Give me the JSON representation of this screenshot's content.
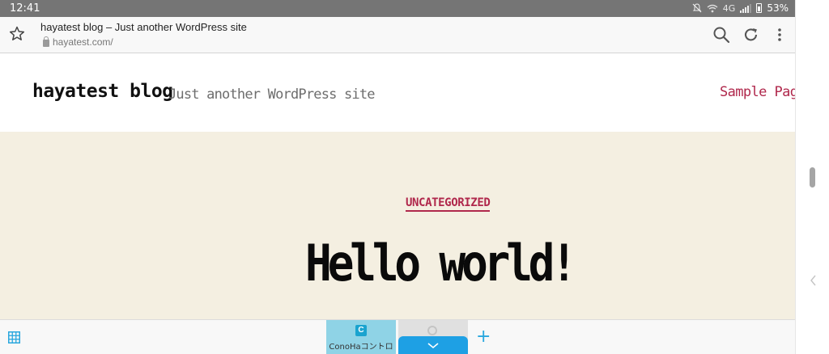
{
  "status_bar": {
    "time": "12:41",
    "network": "4G",
    "battery": "53%",
    "icons": [
      "mute-bell-icon",
      "wifi-icon",
      "signal-icon",
      "battery-icon"
    ]
  },
  "browser": {
    "page_title": "hayatest blog – Just another WordPress site",
    "url": "hayatest.com/",
    "icons": [
      "bookmark-star-icon",
      "lock-icon",
      "search-icon",
      "reload-icon",
      "more-menu-icon"
    ]
  },
  "site": {
    "title": "hayatest blog",
    "description": "Just another WordPress site",
    "nav": {
      "sample_page": "Sample Page"
    }
  },
  "post": {
    "category": "UNCATEGORIZED",
    "title": "Hello world!"
  },
  "bottom_bar": {
    "tabs": [
      {
        "label": "ConoHaコントロ",
        "icon_letter": "C"
      }
    ],
    "icons": [
      "tab-grid-icon",
      "new-tab-plus-icon",
      "chevron-down-icon"
    ]
  },
  "colors": {
    "accent": "#b0284c",
    "hero_bg": "#f4efe1",
    "tab_active": "#8fd3e6",
    "tab_blue": "#1ea0e4"
  }
}
